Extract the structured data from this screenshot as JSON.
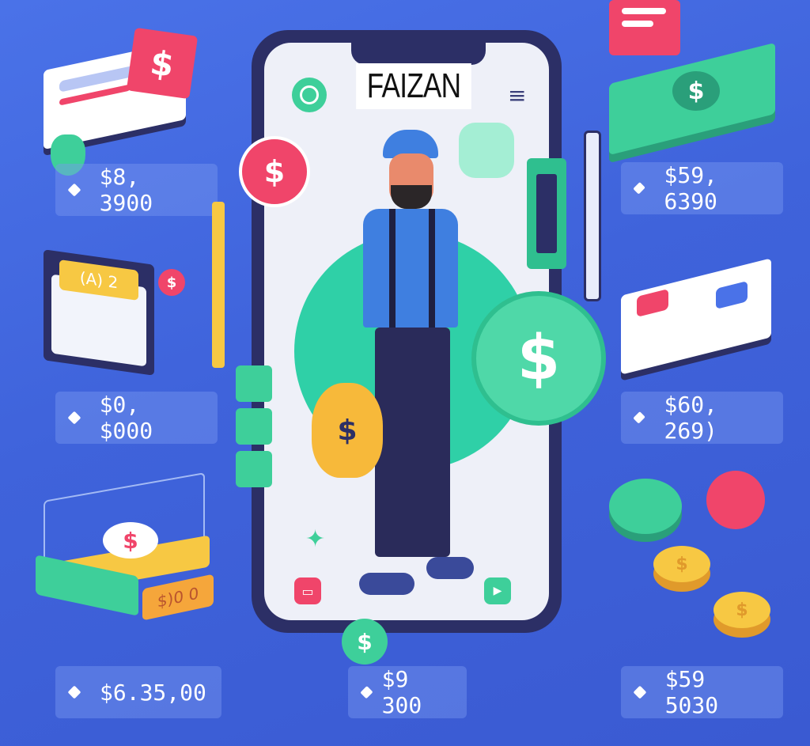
{
  "app": {
    "title": "FAIZAN"
  },
  "amounts": {
    "left_1": "$8, 3900",
    "left_2": "$0, $000",
    "left_3": "$6.35,00",
    "center": "$9 300",
    "right_1": "$59, 6390",
    "right_2": "$60, 269)",
    "right_3": "$59 5030"
  },
  "labels": {
    "book_badge": "(A) 2",
    "stack_label": "$)0 0"
  },
  "icons": {
    "dollar": "$",
    "menu": "≡",
    "play": "▶"
  },
  "colors": {
    "background": "#4169e1",
    "accent_green": "#3ecf9a",
    "accent_pink": "#f0456a",
    "accent_yellow": "#f7c843",
    "phone_frame": "#2c2f66"
  }
}
